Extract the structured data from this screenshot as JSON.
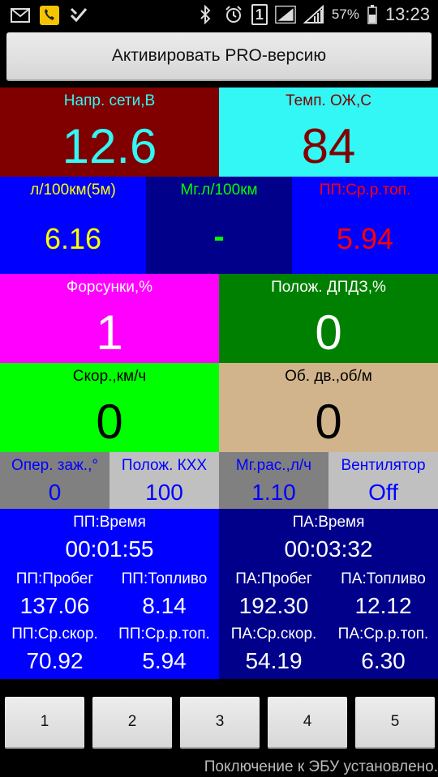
{
  "status_bar": {
    "left_icons": [
      "mail-icon",
      "phone-app-icon",
      "check-app-icon"
    ],
    "right_icons": [
      "bluetooth-icon",
      "alarm-icon",
      "sim-1-icon",
      "signal-icon",
      "wifi-signal-icon",
      "battery-icon"
    ],
    "sim_label": "1",
    "battery_percent": "57%",
    "time": "13:23"
  },
  "pro_button": {
    "label": "Активировать PRO-версию"
  },
  "tiles": {
    "voltage": {
      "label": "Напр. сети,В",
      "value": "12.6"
    },
    "coolant": {
      "label": "Темп. ОЖ,С",
      "value": "84"
    },
    "fuel5m": {
      "label": "л/100км(5м)",
      "value": "6.16"
    },
    "instant": {
      "label": "Мг.л/100км",
      "value": "-"
    },
    "trip_avg_fuel": {
      "label": "ПП:Ср.р.топ.",
      "value": "5.94"
    },
    "injectors": {
      "label": "Форсунки,%",
      "value": "1"
    },
    "throttle": {
      "label": "Полож. ДПДЗ,%",
      "value": "0"
    },
    "speed": {
      "label": "Скор.,км/ч",
      "value": "0"
    },
    "rpm": {
      "label": "Об. дв.,об/м",
      "value": "0"
    },
    "ignition": {
      "label": "Опер. заж.,°",
      "value": "0"
    },
    "iac": {
      "label": "Полож. КХХ",
      "value": "100"
    },
    "inst_flow": {
      "label": "Мг.рас.,л/ч",
      "value": "1.10"
    },
    "fan": {
      "label": "Вентилятор",
      "value": "Off"
    }
  },
  "trip_current": {
    "time_label": "ПП:Время",
    "time_value": "00:01:55",
    "distance_label": "ПП:Пробег",
    "distance_value": "137.06",
    "fuel_label": "ПП:Топливо",
    "fuel_value": "8.14",
    "avg_speed_label": "ПП:Ср.скор.",
    "avg_speed_value": "70.92",
    "avg_fuel_label": "ПП:Ср.р.топ.",
    "avg_fuel_value": "5.94"
  },
  "trip_total": {
    "time_label": "ПА:Время",
    "time_value": "00:03:32",
    "distance_label": "ПА:Пробег",
    "distance_value": "192.30",
    "fuel_label": "ПА:Топливо",
    "fuel_value": "12.12",
    "avg_speed_label": "ПА:Ср.скор.",
    "avg_speed_value": "54.19",
    "avg_fuel_label": "ПА:Ср.р.топ.",
    "avg_fuel_value": "6.30"
  },
  "page_buttons": [
    "1",
    "2",
    "3",
    "4",
    "5"
  ],
  "connection_status": "Поключение к ЭБУ установлено.",
  "colors": {
    "dark_red": "#800000",
    "cyan": "#33f7f4",
    "blue": "#0000ff",
    "navy": "#00008b",
    "magenta": "#ff00ff",
    "green": "#008000",
    "lime": "#00ff00",
    "tan": "#d2b48c",
    "gray": "#808080",
    "light_gray": "#c0c0c0",
    "yellow": "#ffff00",
    "red": "#ff0000"
  }
}
